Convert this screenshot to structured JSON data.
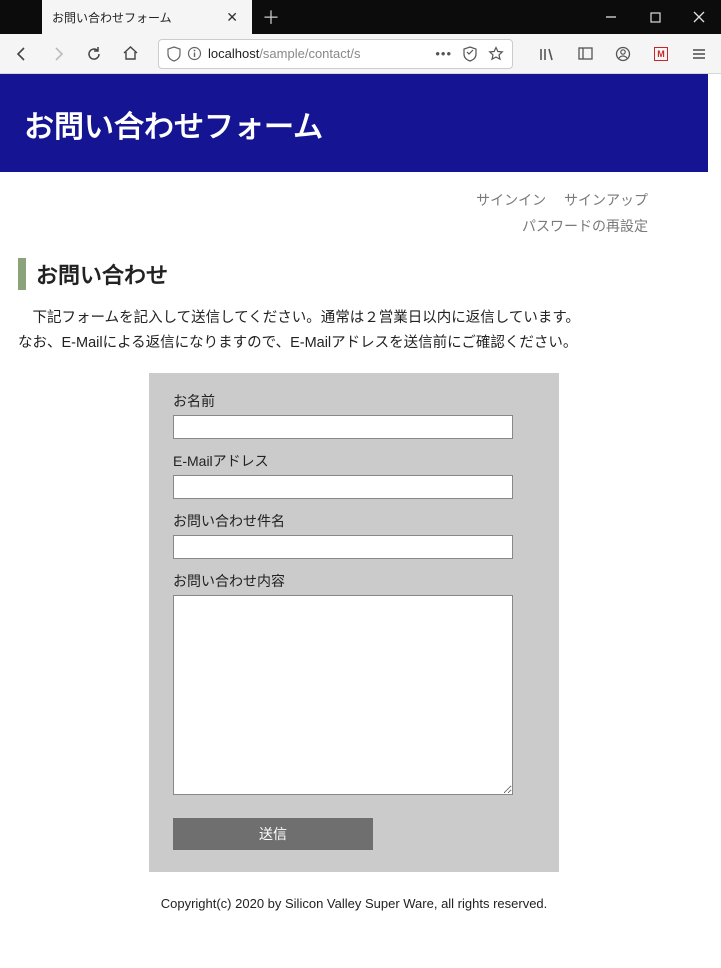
{
  "browser": {
    "tab_title": "お問い合わせフォーム",
    "url_display_host": "localhost",
    "url_display_path": "/sample/contact/s"
  },
  "header": {
    "title": "お問い合わせフォーム"
  },
  "nav": {
    "signin": "サインイン",
    "signup": "サインアップ",
    "password_reset": "パスワードの再設定"
  },
  "section": {
    "title": "お問い合わせ",
    "intro_line1": "下記フォームを記入して送信してください。通常は２営業日以内に返信しています。",
    "intro_line2": "なお、E-Mailによる返信になりますので、E-Mailアドレスを送信前にご確認ください。"
  },
  "form": {
    "name_label": "お名前",
    "name_value": "",
    "email_label": "E-Mailアドレス",
    "email_value": "",
    "subject_label": "お問い合わせ件名",
    "subject_value": "",
    "body_label": "お問い合わせ内容",
    "body_value": "",
    "submit_label": "送信"
  },
  "footer": {
    "copyright": "Copyright(c) 2020 by Silicon Valley Super Ware, all rights reserved."
  }
}
